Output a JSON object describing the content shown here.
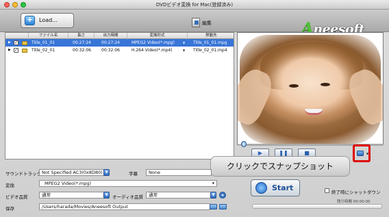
{
  "window": {
    "title": "DVDビデオ変換 for Mac(登録済み)"
  },
  "toolbar": {
    "load_label": "Load...",
    "edit_label": "編集",
    "logo_first": "A",
    "logo_rest": "neesoft"
  },
  "table": {
    "headers": [
      "ファイル名",
      "長さ",
      "出力時間",
      "変換形式",
      "移動先"
    ],
    "rows": [
      {
        "name": "Title_01_01",
        "length": "00:27:24",
        "output_time": "00:27:24",
        "format": "MPEG2 Video(*.mpg)",
        "dest": "Title_01_01.mpg",
        "selected": true
      },
      {
        "name": "Title_02_01",
        "length": "00:32:06",
        "output_time": "00:32:06",
        "format": "H.264 Video(*.mp4)",
        "dest": "Title_02_01.mp4",
        "selected": false
      }
    ]
  },
  "settings": {
    "soundtrack_label": "サウンドトラック",
    "soundtrack_value": "Not Specified AC3(0x8D80)",
    "subtitle_label": "字幕",
    "subtitle_value": "None",
    "convert_label": "変換",
    "convert_value": "MPEG2 Video(*.mpg)",
    "video_quality_label": "ビデオ品質",
    "video_quality_value": "通常",
    "audio_quality_label": "オーディオ品質",
    "audio_quality_value": "通常",
    "save_label": "保存",
    "save_value": "/Users/harada/Movies/Aneesoft Output"
  },
  "actions": {
    "start_label": "Start",
    "shutdown_label": "終了時にシャットダウン",
    "remaining_label": "残り時間 00:00:00"
  },
  "tooltip": {
    "text": "クリックでスナップショット"
  },
  "colors": {
    "selection": "#3875d7",
    "highlight_box": "#e00000",
    "logo_green": "#4fbf3a"
  }
}
